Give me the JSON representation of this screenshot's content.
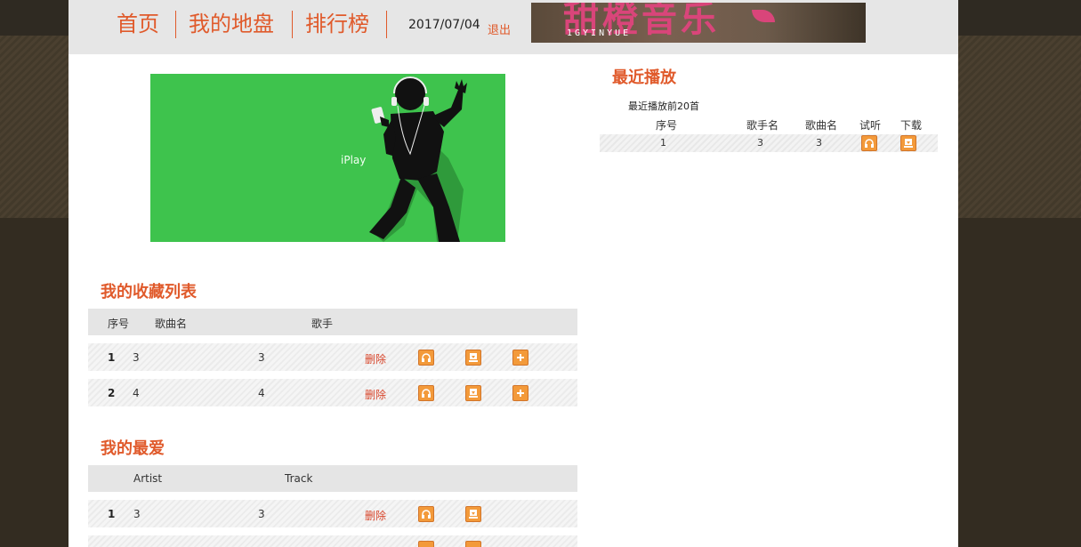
{
  "header": {
    "nav": [
      "首页",
      "我的地盘",
      "排行榜"
    ],
    "date": "2017/07/04",
    "logout": "退出",
    "banner_text": "甜橙音乐",
    "banner_sub": "1GYINYUE"
  },
  "hero": {
    "label": "iPlay"
  },
  "favorites": {
    "title": "我的收藏列表",
    "columns": [
      "序号",
      "歌曲名",
      "歌手"
    ],
    "rows": [
      {
        "index": "1",
        "song": "3",
        "artist": "3",
        "delete": "删除"
      },
      {
        "index": "2",
        "song": "4",
        "artist": "4",
        "delete": "删除"
      }
    ]
  },
  "loves": {
    "title": "我的最爱",
    "columns": [
      "Artist",
      "Track"
    ],
    "rows": [
      {
        "index": "1",
        "artist": "3",
        "track": "3",
        "delete": "删除"
      }
    ]
  },
  "recent": {
    "title": "最近播放",
    "caption": "最近播放前20首",
    "columns": [
      "序号",
      "歌手名",
      "歌曲名",
      "试听",
      "下载"
    ],
    "rows": [
      {
        "index": "1",
        "singer": "3",
        "song": "3"
      }
    ]
  },
  "icons": {
    "listen": "headphones-icon",
    "download": "download-icon",
    "add": "plus-icon"
  },
  "colors": {
    "accent": "#e05a2b",
    "icon_bg": "#f39a3a",
    "hero_bg": "#3ec34d",
    "header_bg": "#e6e6e6"
  }
}
